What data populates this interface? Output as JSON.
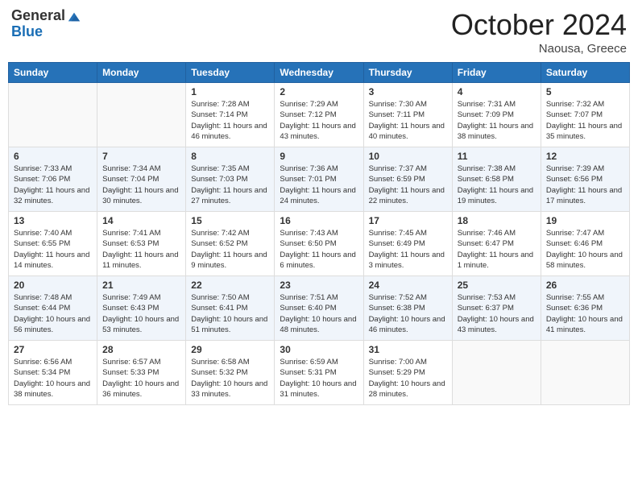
{
  "header": {
    "logo_general": "General",
    "logo_blue": "Blue",
    "month_title": "October 2024",
    "location": "Naousa, Greece"
  },
  "days_of_week": [
    "Sunday",
    "Monday",
    "Tuesday",
    "Wednesday",
    "Thursday",
    "Friday",
    "Saturday"
  ],
  "weeks": [
    [
      {
        "day": "",
        "sunrise": "",
        "sunset": "",
        "daylight": ""
      },
      {
        "day": "",
        "sunrise": "",
        "sunset": "",
        "daylight": ""
      },
      {
        "day": "1",
        "sunrise": "Sunrise: 7:28 AM",
        "sunset": "Sunset: 7:14 PM",
        "daylight": "Daylight: 11 hours and 46 minutes."
      },
      {
        "day": "2",
        "sunrise": "Sunrise: 7:29 AM",
        "sunset": "Sunset: 7:12 PM",
        "daylight": "Daylight: 11 hours and 43 minutes."
      },
      {
        "day": "3",
        "sunrise": "Sunrise: 7:30 AM",
        "sunset": "Sunset: 7:11 PM",
        "daylight": "Daylight: 11 hours and 40 minutes."
      },
      {
        "day": "4",
        "sunrise": "Sunrise: 7:31 AM",
        "sunset": "Sunset: 7:09 PM",
        "daylight": "Daylight: 11 hours and 38 minutes."
      },
      {
        "day": "5",
        "sunrise": "Sunrise: 7:32 AM",
        "sunset": "Sunset: 7:07 PM",
        "daylight": "Daylight: 11 hours and 35 minutes."
      }
    ],
    [
      {
        "day": "6",
        "sunrise": "Sunrise: 7:33 AM",
        "sunset": "Sunset: 7:06 PM",
        "daylight": "Daylight: 11 hours and 32 minutes."
      },
      {
        "day": "7",
        "sunrise": "Sunrise: 7:34 AM",
        "sunset": "Sunset: 7:04 PM",
        "daylight": "Daylight: 11 hours and 30 minutes."
      },
      {
        "day": "8",
        "sunrise": "Sunrise: 7:35 AM",
        "sunset": "Sunset: 7:03 PM",
        "daylight": "Daylight: 11 hours and 27 minutes."
      },
      {
        "day": "9",
        "sunrise": "Sunrise: 7:36 AM",
        "sunset": "Sunset: 7:01 PM",
        "daylight": "Daylight: 11 hours and 24 minutes."
      },
      {
        "day": "10",
        "sunrise": "Sunrise: 7:37 AM",
        "sunset": "Sunset: 6:59 PM",
        "daylight": "Daylight: 11 hours and 22 minutes."
      },
      {
        "day": "11",
        "sunrise": "Sunrise: 7:38 AM",
        "sunset": "Sunset: 6:58 PM",
        "daylight": "Daylight: 11 hours and 19 minutes."
      },
      {
        "day": "12",
        "sunrise": "Sunrise: 7:39 AM",
        "sunset": "Sunset: 6:56 PM",
        "daylight": "Daylight: 11 hours and 17 minutes."
      }
    ],
    [
      {
        "day": "13",
        "sunrise": "Sunrise: 7:40 AM",
        "sunset": "Sunset: 6:55 PM",
        "daylight": "Daylight: 11 hours and 14 minutes."
      },
      {
        "day": "14",
        "sunrise": "Sunrise: 7:41 AM",
        "sunset": "Sunset: 6:53 PM",
        "daylight": "Daylight: 11 hours and 11 minutes."
      },
      {
        "day": "15",
        "sunrise": "Sunrise: 7:42 AM",
        "sunset": "Sunset: 6:52 PM",
        "daylight": "Daylight: 11 hours and 9 minutes."
      },
      {
        "day": "16",
        "sunrise": "Sunrise: 7:43 AM",
        "sunset": "Sunset: 6:50 PM",
        "daylight": "Daylight: 11 hours and 6 minutes."
      },
      {
        "day": "17",
        "sunrise": "Sunrise: 7:45 AM",
        "sunset": "Sunset: 6:49 PM",
        "daylight": "Daylight: 11 hours and 3 minutes."
      },
      {
        "day": "18",
        "sunrise": "Sunrise: 7:46 AM",
        "sunset": "Sunset: 6:47 PM",
        "daylight": "Daylight: 11 hours and 1 minute."
      },
      {
        "day": "19",
        "sunrise": "Sunrise: 7:47 AM",
        "sunset": "Sunset: 6:46 PM",
        "daylight": "Daylight: 10 hours and 58 minutes."
      }
    ],
    [
      {
        "day": "20",
        "sunrise": "Sunrise: 7:48 AM",
        "sunset": "Sunset: 6:44 PM",
        "daylight": "Daylight: 10 hours and 56 minutes."
      },
      {
        "day": "21",
        "sunrise": "Sunrise: 7:49 AM",
        "sunset": "Sunset: 6:43 PM",
        "daylight": "Daylight: 10 hours and 53 minutes."
      },
      {
        "day": "22",
        "sunrise": "Sunrise: 7:50 AM",
        "sunset": "Sunset: 6:41 PM",
        "daylight": "Daylight: 10 hours and 51 minutes."
      },
      {
        "day": "23",
        "sunrise": "Sunrise: 7:51 AM",
        "sunset": "Sunset: 6:40 PM",
        "daylight": "Daylight: 10 hours and 48 minutes."
      },
      {
        "day": "24",
        "sunrise": "Sunrise: 7:52 AM",
        "sunset": "Sunset: 6:38 PM",
        "daylight": "Daylight: 10 hours and 46 minutes."
      },
      {
        "day": "25",
        "sunrise": "Sunrise: 7:53 AM",
        "sunset": "Sunset: 6:37 PM",
        "daylight": "Daylight: 10 hours and 43 minutes."
      },
      {
        "day": "26",
        "sunrise": "Sunrise: 7:55 AM",
        "sunset": "Sunset: 6:36 PM",
        "daylight": "Daylight: 10 hours and 41 minutes."
      }
    ],
    [
      {
        "day": "27",
        "sunrise": "Sunrise: 6:56 AM",
        "sunset": "Sunset: 5:34 PM",
        "daylight": "Daylight: 10 hours and 38 minutes."
      },
      {
        "day": "28",
        "sunrise": "Sunrise: 6:57 AM",
        "sunset": "Sunset: 5:33 PM",
        "daylight": "Daylight: 10 hours and 36 minutes."
      },
      {
        "day": "29",
        "sunrise": "Sunrise: 6:58 AM",
        "sunset": "Sunset: 5:32 PM",
        "daylight": "Daylight: 10 hours and 33 minutes."
      },
      {
        "day": "30",
        "sunrise": "Sunrise: 6:59 AM",
        "sunset": "Sunset: 5:31 PM",
        "daylight": "Daylight: 10 hours and 31 minutes."
      },
      {
        "day": "31",
        "sunrise": "Sunrise: 7:00 AM",
        "sunset": "Sunset: 5:29 PM",
        "daylight": "Daylight: 10 hours and 28 minutes."
      },
      {
        "day": "",
        "sunrise": "",
        "sunset": "",
        "daylight": ""
      },
      {
        "day": "",
        "sunrise": "",
        "sunset": "",
        "daylight": ""
      }
    ]
  ]
}
